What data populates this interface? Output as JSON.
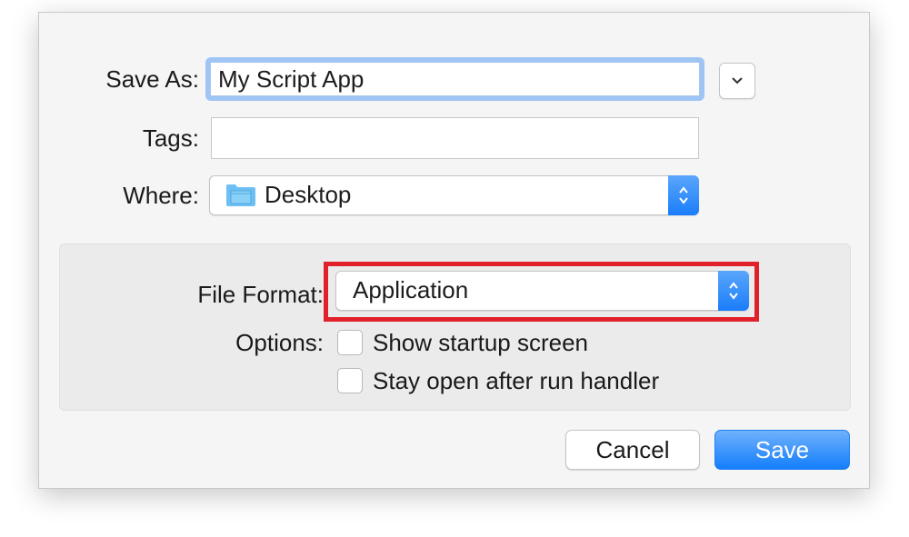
{
  "dialog": {
    "save_as": {
      "label": "Save As:",
      "value": "My Script App"
    },
    "tags": {
      "label": "Tags:",
      "value": ""
    },
    "where": {
      "label": "Where:",
      "value": "Desktop",
      "icon": "folder-icon"
    },
    "file_format": {
      "label": "File Format:",
      "value": "Application"
    },
    "options": {
      "label": "Options:",
      "items": [
        {
          "label": "Show startup screen",
          "checked": false
        },
        {
          "label": "Stay open after run handler",
          "checked": false
        }
      ]
    },
    "buttons": {
      "cancel": "Cancel",
      "save": "Save"
    },
    "colors": {
      "accent": "#1a7dfa",
      "highlight": "#e0202a",
      "focus_ring": "#9ec5f5"
    }
  }
}
